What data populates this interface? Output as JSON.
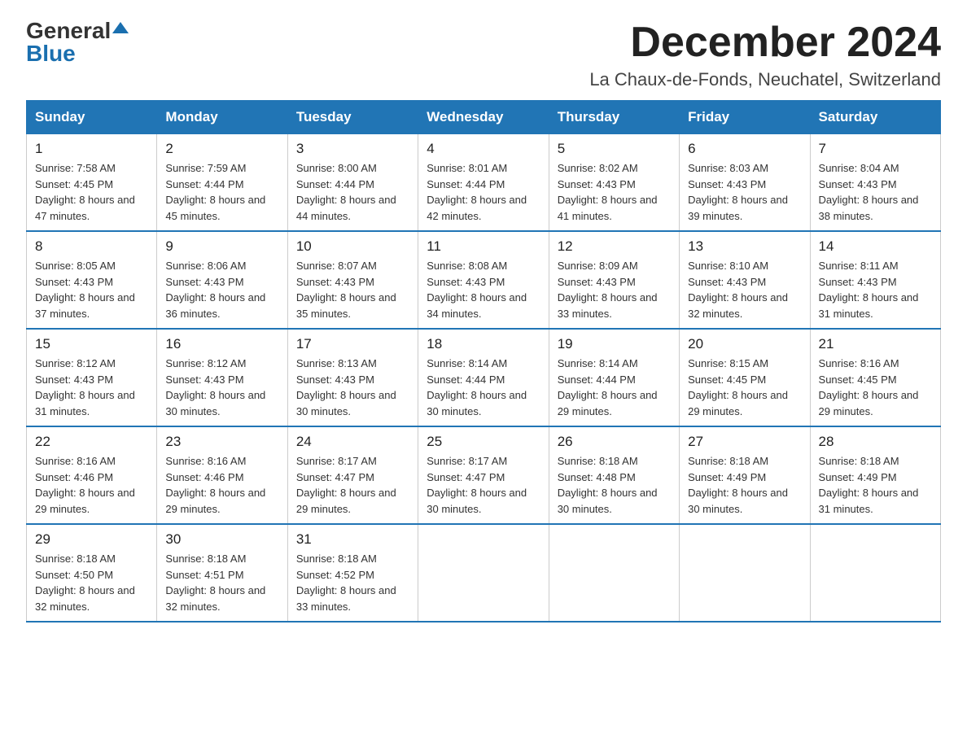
{
  "header": {
    "logo_general": "General",
    "logo_blue": "Blue",
    "month_title": "December 2024",
    "location": "La Chaux-de-Fonds, Neuchatel, Switzerland"
  },
  "weekdays": [
    "Sunday",
    "Monday",
    "Tuesday",
    "Wednesday",
    "Thursday",
    "Friday",
    "Saturday"
  ],
  "weeks": [
    [
      {
        "day": "1",
        "sunrise": "7:58 AM",
        "sunset": "4:45 PM",
        "daylight": "8 hours and 47 minutes."
      },
      {
        "day": "2",
        "sunrise": "7:59 AM",
        "sunset": "4:44 PM",
        "daylight": "8 hours and 45 minutes."
      },
      {
        "day": "3",
        "sunrise": "8:00 AM",
        "sunset": "4:44 PM",
        "daylight": "8 hours and 44 minutes."
      },
      {
        "day": "4",
        "sunrise": "8:01 AM",
        "sunset": "4:44 PM",
        "daylight": "8 hours and 42 minutes."
      },
      {
        "day": "5",
        "sunrise": "8:02 AM",
        "sunset": "4:43 PM",
        "daylight": "8 hours and 41 minutes."
      },
      {
        "day": "6",
        "sunrise": "8:03 AM",
        "sunset": "4:43 PM",
        "daylight": "8 hours and 39 minutes."
      },
      {
        "day": "7",
        "sunrise": "8:04 AM",
        "sunset": "4:43 PM",
        "daylight": "8 hours and 38 minutes."
      }
    ],
    [
      {
        "day": "8",
        "sunrise": "8:05 AM",
        "sunset": "4:43 PM",
        "daylight": "8 hours and 37 minutes."
      },
      {
        "day": "9",
        "sunrise": "8:06 AM",
        "sunset": "4:43 PM",
        "daylight": "8 hours and 36 minutes."
      },
      {
        "day": "10",
        "sunrise": "8:07 AM",
        "sunset": "4:43 PM",
        "daylight": "8 hours and 35 minutes."
      },
      {
        "day": "11",
        "sunrise": "8:08 AM",
        "sunset": "4:43 PM",
        "daylight": "8 hours and 34 minutes."
      },
      {
        "day": "12",
        "sunrise": "8:09 AM",
        "sunset": "4:43 PM",
        "daylight": "8 hours and 33 minutes."
      },
      {
        "day": "13",
        "sunrise": "8:10 AM",
        "sunset": "4:43 PM",
        "daylight": "8 hours and 32 minutes."
      },
      {
        "day": "14",
        "sunrise": "8:11 AM",
        "sunset": "4:43 PM",
        "daylight": "8 hours and 31 minutes."
      }
    ],
    [
      {
        "day": "15",
        "sunrise": "8:12 AM",
        "sunset": "4:43 PM",
        "daylight": "8 hours and 31 minutes."
      },
      {
        "day": "16",
        "sunrise": "8:12 AM",
        "sunset": "4:43 PM",
        "daylight": "8 hours and 30 minutes."
      },
      {
        "day": "17",
        "sunrise": "8:13 AM",
        "sunset": "4:43 PM",
        "daylight": "8 hours and 30 minutes."
      },
      {
        "day": "18",
        "sunrise": "8:14 AM",
        "sunset": "4:44 PM",
        "daylight": "8 hours and 30 minutes."
      },
      {
        "day": "19",
        "sunrise": "8:14 AM",
        "sunset": "4:44 PM",
        "daylight": "8 hours and 29 minutes."
      },
      {
        "day": "20",
        "sunrise": "8:15 AM",
        "sunset": "4:45 PM",
        "daylight": "8 hours and 29 minutes."
      },
      {
        "day": "21",
        "sunrise": "8:16 AM",
        "sunset": "4:45 PM",
        "daylight": "8 hours and 29 minutes."
      }
    ],
    [
      {
        "day": "22",
        "sunrise": "8:16 AM",
        "sunset": "4:46 PM",
        "daylight": "8 hours and 29 minutes."
      },
      {
        "day": "23",
        "sunrise": "8:16 AM",
        "sunset": "4:46 PM",
        "daylight": "8 hours and 29 minutes."
      },
      {
        "day": "24",
        "sunrise": "8:17 AM",
        "sunset": "4:47 PM",
        "daylight": "8 hours and 29 minutes."
      },
      {
        "day": "25",
        "sunrise": "8:17 AM",
        "sunset": "4:47 PM",
        "daylight": "8 hours and 30 minutes."
      },
      {
        "day": "26",
        "sunrise": "8:18 AM",
        "sunset": "4:48 PM",
        "daylight": "8 hours and 30 minutes."
      },
      {
        "day": "27",
        "sunrise": "8:18 AM",
        "sunset": "4:49 PM",
        "daylight": "8 hours and 30 minutes."
      },
      {
        "day": "28",
        "sunrise": "8:18 AM",
        "sunset": "4:49 PM",
        "daylight": "8 hours and 31 minutes."
      }
    ],
    [
      {
        "day": "29",
        "sunrise": "8:18 AM",
        "sunset": "4:50 PM",
        "daylight": "8 hours and 32 minutes."
      },
      {
        "day": "30",
        "sunrise": "8:18 AM",
        "sunset": "4:51 PM",
        "daylight": "8 hours and 32 minutes."
      },
      {
        "day": "31",
        "sunrise": "8:18 AM",
        "sunset": "4:52 PM",
        "daylight": "8 hours and 33 minutes."
      },
      null,
      null,
      null,
      null
    ]
  ]
}
